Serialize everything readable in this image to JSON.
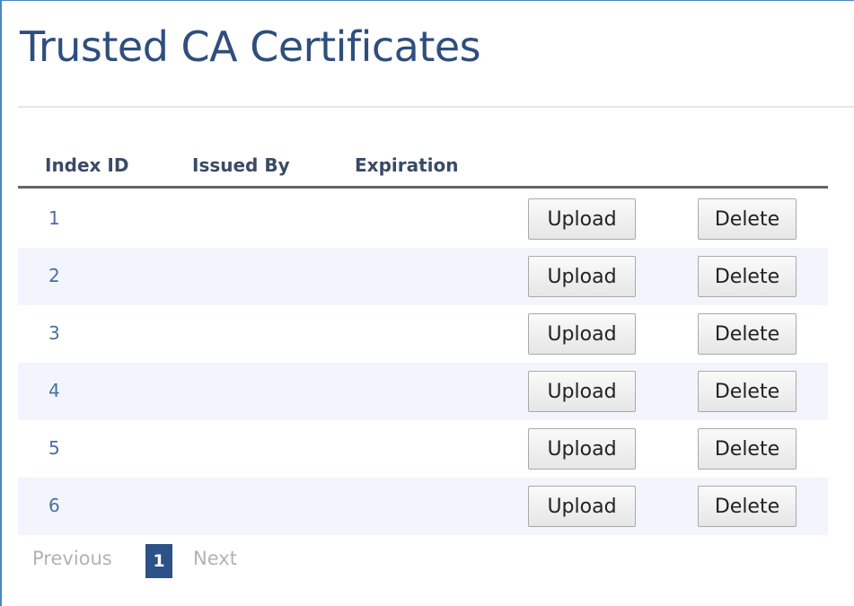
{
  "page": {
    "title": "Trusted CA Certificates"
  },
  "table": {
    "headers": {
      "index_id": "Index ID",
      "issued_by": "Issued By",
      "expiration": "Expiration"
    },
    "rows": [
      {
        "index": "1",
        "issued_by": "",
        "expiration": "",
        "upload_label": "Upload",
        "delete_label": "Delete"
      },
      {
        "index": "2",
        "issued_by": "",
        "expiration": "",
        "upload_label": "Upload",
        "delete_label": "Delete"
      },
      {
        "index": "3",
        "issued_by": "",
        "expiration": "",
        "upload_label": "Upload",
        "delete_label": "Delete"
      },
      {
        "index": "4",
        "issued_by": "",
        "expiration": "",
        "upload_label": "Upload",
        "delete_label": "Delete"
      },
      {
        "index": "5",
        "issued_by": "",
        "expiration": "",
        "upload_label": "Upload",
        "delete_label": "Delete"
      },
      {
        "index": "6",
        "issued_by": "",
        "expiration": "",
        "upload_label": "Upload",
        "delete_label": "Delete"
      }
    ]
  },
  "pagination": {
    "previous_label": "Previous",
    "current_page": "1",
    "next_label": "Next"
  },
  "colors": {
    "title": "#2f4e7e",
    "frame_border": "#4a86c8",
    "alt_row": "#f2f5fb",
    "active_page": "#2d5287",
    "disabled_link": "#b3b3b3"
  }
}
